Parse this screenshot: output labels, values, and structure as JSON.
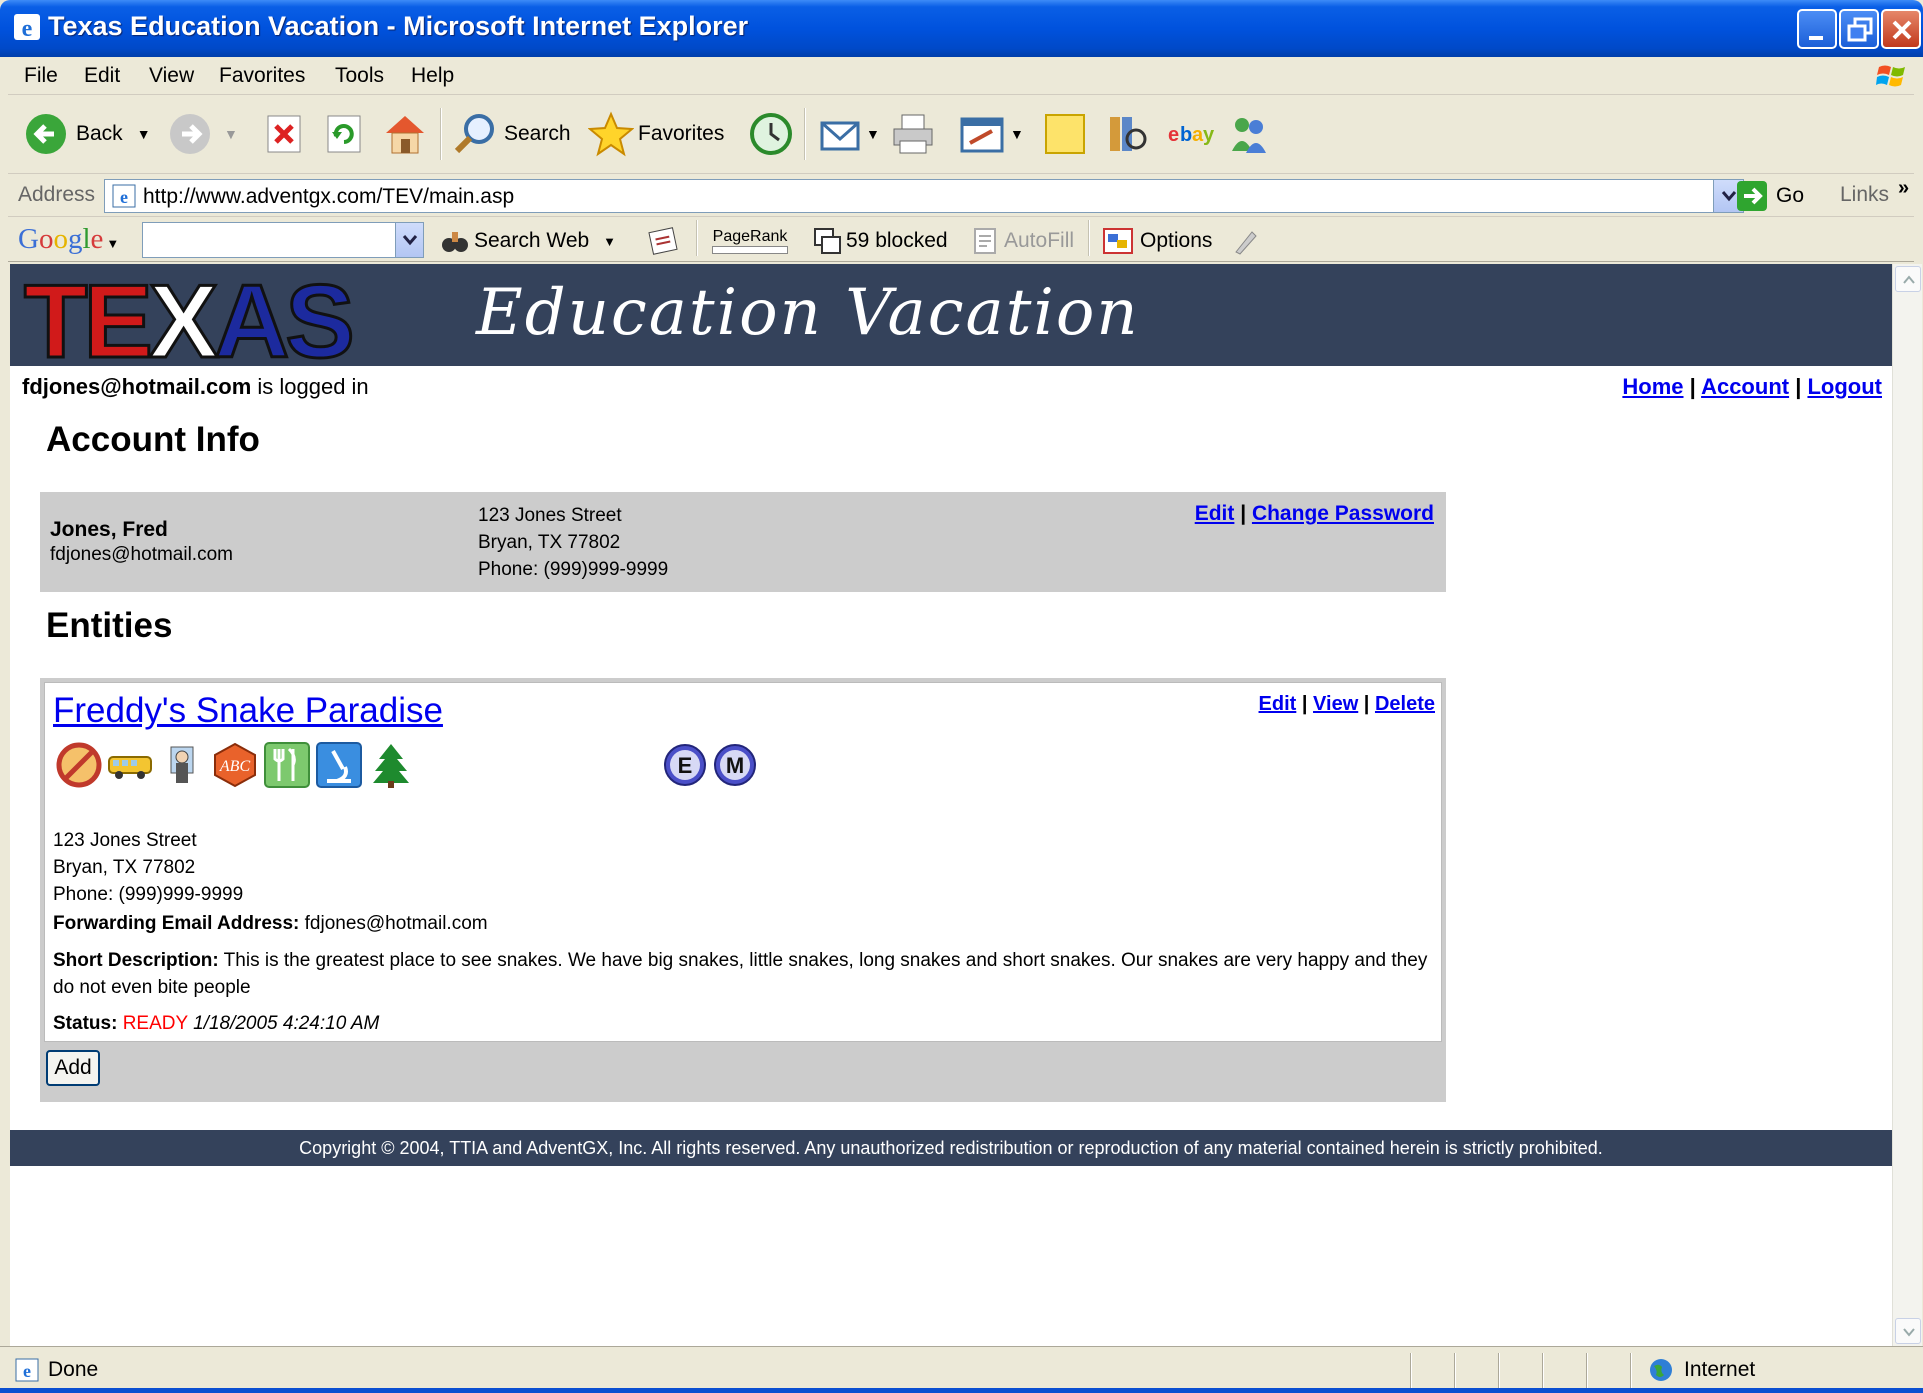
{
  "window": {
    "title": "Texas Education Vacation - Microsoft Internet Explorer"
  },
  "menu": [
    "File",
    "Edit",
    "View",
    "Favorites",
    "Tools",
    "Help"
  ],
  "toolbar": {
    "back": "Back",
    "search": "Search",
    "favorites": "Favorites"
  },
  "address": {
    "label": "Address",
    "url": "http://www.adventgx.com/TEV/main.asp",
    "go": "Go",
    "links": "Links"
  },
  "googlebar": {
    "logo": "Google",
    "search_web": "Search Web",
    "pagerank": "PageRank",
    "blocked": "59 blocked",
    "autofill": "AutoFill",
    "options": "Options"
  },
  "banner": {
    "word_texas_1": "TE",
    "word_texas_2": "X",
    "word_texas_3": "AS",
    "tagline": "Education Vacation"
  },
  "session": {
    "user": "fdjones@hotmail.com",
    "suffix": " is logged in"
  },
  "toplinks": {
    "home": "Home",
    "account": "Account",
    "logout": "Logout",
    "sep": " | "
  },
  "account": {
    "heading": "Account Info",
    "name": "Jones, Fred",
    "email": "fdjones@hotmail.com",
    "street": "123 Jones Street",
    "city": "Bryan, TX  77802",
    "phone": "Phone: (999)999-9999",
    "edit": "Edit",
    "change_password": "Change Password"
  },
  "entities": {
    "heading": "Entities",
    "items": [
      {
        "name": "Freddy's Snake Paradise",
        "edit": "Edit",
        "view": "View",
        "delete": "Delete",
        "badges": [
          "E",
          "M"
        ],
        "street": "123 Jones Street",
        "city": "Bryan, TX  77802",
        "phone": "Phone: (999)999-9999",
        "fwd_label": "Forwarding Email Address:",
        "fwd_value": "fdjones@hotmail.com",
        "desc_label": "Short Description:",
        "desc_value": "This is the greatest place to see snakes. We have big snakes, little snakes, long snakes and short snakes. Our snakes are very happy and they do not even bite people",
        "status_label": "Status:",
        "status_value": "READY",
        "status_time": "1/18/2005 4:24:10 AM"
      }
    ],
    "add_button": "Add"
  },
  "footer": "Copyright © 2004, TTIA and AdventGX, Inc. All rights reserved. Any unauthorized redistribution or reproduction of any material contained herein is strictly prohibited.",
  "statusbar": {
    "left": "Done",
    "zone": "Internet"
  },
  "colors": {
    "banner_bg": "#34425b",
    "texas_red": "#d11a1a",
    "texas_blue": "#1c2a9e",
    "status_ready": "#ff0000"
  }
}
